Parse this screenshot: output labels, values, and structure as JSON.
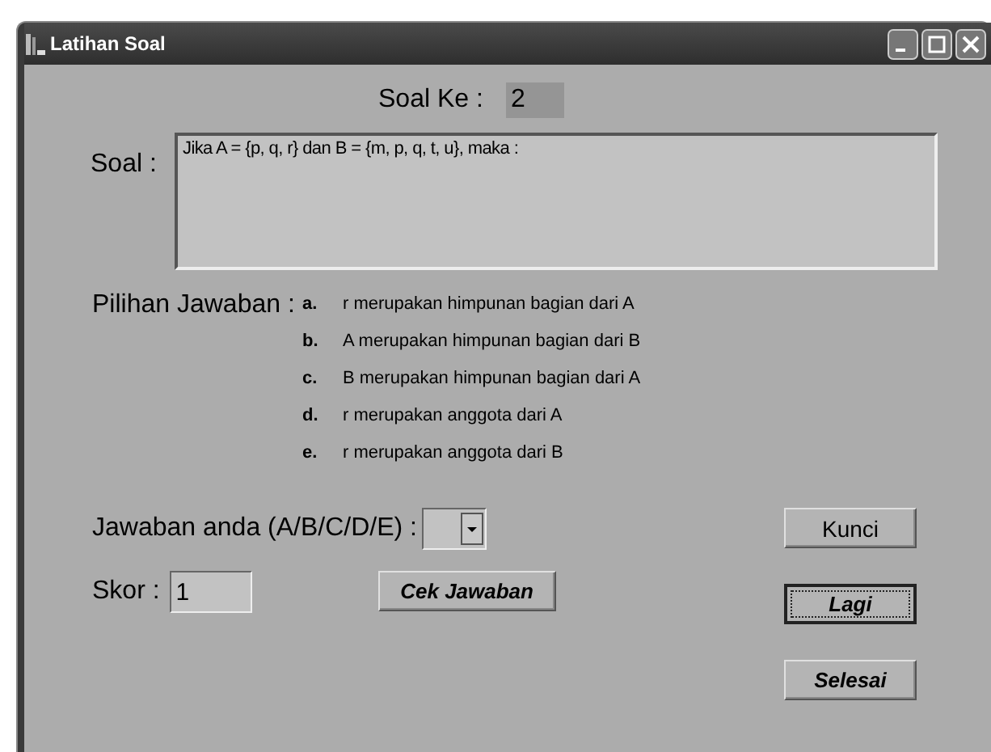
{
  "window": {
    "title": "Latihan Soal"
  },
  "question_number": {
    "label": "Soal Ke :",
    "value": "2"
  },
  "question": {
    "label": "Soal :",
    "text": "Jika A = {p, q, r} dan B = {m, p, q, t, u}, maka :"
  },
  "choices": {
    "label": "Pilihan Jawaban :",
    "options": [
      {
        "letter": "a.",
        "text": "r merupakan himpunan bagian dari A"
      },
      {
        "letter": "b.",
        "text": "A merupakan himpunan bagian dari B"
      },
      {
        "letter": "c.",
        "text": "B merupakan himpunan bagian dari A"
      },
      {
        "letter": "d.",
        "text": "r merupakan anggota dari A"
      },
      {
        "letter": "e.",
        "text": "r merupakan anggota dari B"
      }
    ]
  },
  "answer": {
    "label": "Jawaban anda (A/B/C/D/E) :"
  },
  "score": {
    "label": "Skor :",
    "value": "1"
  },
  "check_button": {
    "label": "Cek Jawaban",
    "kind": "italic",
    "focused": false
  },
  "side_buttons": [
    {
      "label": "Kunci",
      "kind": "plain",
      "focused": false
    },
    {
      "label": "Lagi",
      "kind": "italic",
      "focused": true
    },
    {
      "label": "Selesai",
      "kind": "italic",
      "focused": false
    }
  ]
}
